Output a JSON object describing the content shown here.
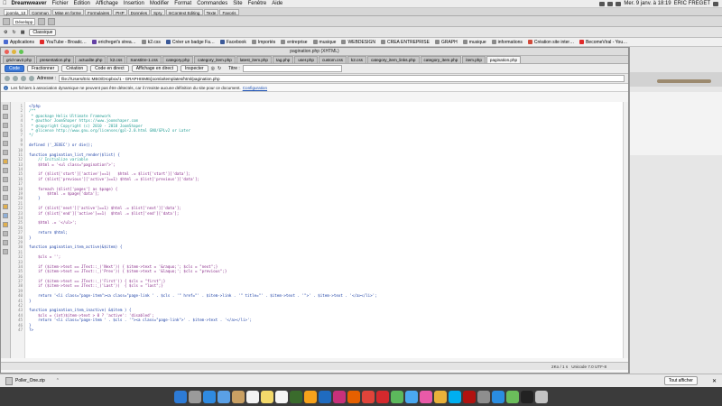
{
  "menubar": {
    "app": "Dreamweaver",
    "items": [
      "Fichier",
      "Edition",
      "Affichage",
      "Insertion",
      "Modifier",
      "Format",
      "Commandes",
      "Site",
      "Fenêtre",
      "Aide"
    ],
    "datetime": "Mer. 9 janv. à 18:19",
    "user": "ERIC FREGET"
  },
  "dw_tabs": [
    "joomla_13",
    "Commun",
    "Mise en forme",
    "Formulaires",
    "PHP",
    "Données",
    "Spry",
    "InContext Editing",
    "Texte",
    "Favoris"
  ],
  "dw_insert": {
    "button": "Développ"
  },
  "browser_toolbar": {
    "style_select": "Classique"
  },
  "bookmarks": [
    "Applications",
    "YouTube - Broadc…",
    "ericfreget's strea…",
    "k2.css",
    "Créer un badge Fa…",
    "Facebook",
    "Importés",
    "entreprise",
    "musique",
    "WEBDESIGN",
    "CREA ENTREPRISE",
    "GRAPH",
    "musique",
    "informations",
    "Création site inter…",
    "BecomeViral - You…"
  ],
  "window": {
    "title": "pagination.php (XHTML)"
  },
  "file_tabs": [
    "grid-nav2.php",
    "presentation.php",
    "actualite.php",
    "k2.css",
    "Sanstitre-1.css",
    "category.php",
    "category_item.php",
    "latest_item.php",
    "tag.php",
    "user.php",
    "custom.css",
    "k2.css",
    "category_item_links.php",
    "category_item.php",
    "item.php",
    "pagination.php"
  ],
  "view_buttons": [
    "Code",
    "Fractionner",
    "Création",
    "Code en direct",
    "Affichage en direct",
    "Inspecter"
  ],
  "title_label": "Titre :",
  "address": {
    "label": "Adresse :",
    "value": "file:///Users/Eric MBO/Dropbox/1 - GRAPHISME/joomla/templates/html/pagination.php"
  },
  "infobar": {
    "message": "Les fichiers à association dynamique ne peuvent pas être détectés, car il n'existe aucune définition du site pour ce document.",
    "link": "Configuration"
  },
  "code_lines": [
    "<?php",
    "/**",
    " * @package Helix Ultimate Framework",
    " * @author JoomShaper https://www.joomshaper.com",
    " * @copyright Copyright (c) 2010 - 2018 JoomShaper",
    " * @license http://www.gnu.org/licenses/gpl-2.0.html GNU/GPLv2 or Later",
    "*/",
    "",
    "defined ('_JEXEC') or die();",
    "",
    "function pagination_list_render($list) {",
    "    // Initialize variable",
    "    $html = '<ul class=\"pagination\">';",
    "",
    "    if ($list['start']['active']==1)   $html .= $list['start']['data'];",
    "    if ($list['previous']['active']==1) $html .= $list['previous']['data'];",
    "",
    "    foreach ($list['pages'] as $page) {",
    "        $html .= $page['data'];",
    "    }",
    "",
    "    if ($list['next']['active']==1) $html .= $list['next']['data'];",
    "    if ($list['end']['active']==1)  $html .= $list['end']['data'];",
    "",
    "    $html .= '</ul>';",
    "",
    "    return $html;",
    "}",
    "",
    "function pagination_item_active(&$item) {",
    "",
    "    $cls = '';",
    "",
    "    if ($item->text == JText::_('Next')) { $item->text = '&raquo;'; $cls = \"next\";}",
    "    if ($item->text == JText::_('Prev')) { $item->text = '&laquo;'; $cls = \"previous\";}",
    "",
    "    if ($item->text == JText::_('First')) { $cls = \"first\";}",
    "    if ($item->text == JText::_('Last'))  { $cls = \"last\";}",
    "",
    "    return '<li class=\"page-item\"><a class=\"page-link ' . $cls . '\" href=\"' . $item->link . '\" title=\"' . $item->text . '\">' . $item->text . '</a></li>';",
    "}",
    "",
    "function pagination_item_inactive( &$item ) {",
    "    $cls = (int)$item->text > 0 ? 'active': 'disabled';",
    "    return '<li class=\"page-item ' . $cls . '\"><a class=\"page-link\">' . $item->text . '</a></li>';",
    "}",
    "?>"
  ],
  "status": {
    "size": "2Ko / 1 s",
    "encoding": "Unicode 7.0 UTF-8"
  },
  "download": {
    "file": "Poller_One.zip",
    "show_all": "Tout afficher"
  },
  "colors": {
    "menubar_bg": "#ededed",
    "active_view_btn": "#3a78d8",
    "dock_bg": "#3b3b3b",
    "desktop_bg": "#6e6e6e"
  },
  "dock_icons": [
    "finder-icon",
    "launchpad-icon",
    "safari-icon",
    "mail-icon",
    "contacts-icon",
    "calendar-icon",
    "notes-icon",
    "reminders-icon",
    "dreamweaver-icon",
    "illustrator-icon",
    "photoshop-icon",
    "indesign-icon",
    "firefox-icon",
    "chrome-icon",
    "opera-icon",
    "facetime-icon",
    "messages-icon",
    "itunes-icon",
    "photos-icon",
    "skype-icon",
    "filezilla-icon",
    "preferences-icon",
    "appstore-icon",
    "maps-icon",
    "terminal-icon",
    "trash-icon"
  ]
}
